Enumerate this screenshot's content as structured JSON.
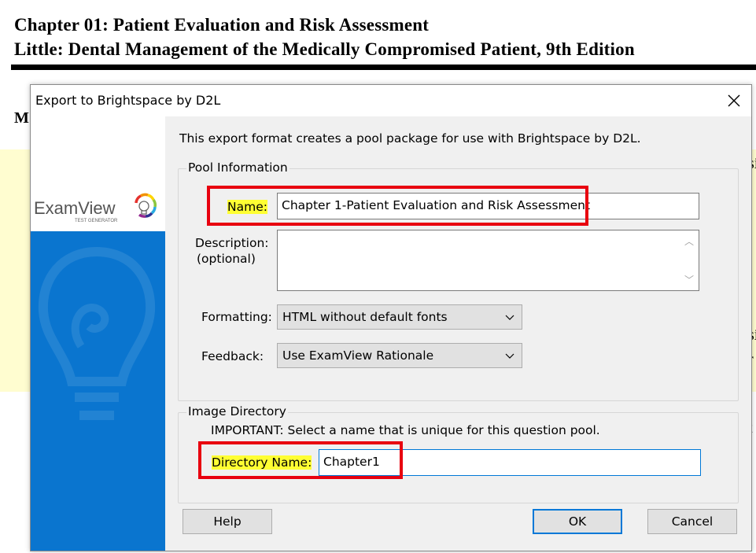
{
  "document": {
    "line1": "Chapter 01: Patient Evaluation and Risk Assessment",
    "line2": "Little: Dental Management of the Medically Compromised Patient, 9th Edition",
    "fragment_m": "M",
    "fragments": [
      "si",
      "si",
      "r",
      "t"
    ]
  },
  "dialog": {
    "title": "Export to Brightspace by D2L",
    "intro": "This export format creates a pool package for use with Brightspace by D2L.",
    "logo": {
      "text": "ExamView",
      "subtitle": "TEST GENERATOR"
    },
    "pool": {
      "legend": "Pool Information",
      "name_label": "Name:",
      "name_value": "Chapter 1-Patient Evaluation and Risk Assessment",
      "description_label_1": "Description:",
      "description_label_2": "(optional)",
      "description_value": "",
      "formatting_label": "Formatting:",
      "formatting_value": "HTML without default fonts",
      "feedback_label": "Feedback:",
      "feedback_value": "Use ExamView Rationale"
    },
    "image_dir": {
      "legend": "Image Directory",
      "important": "IMPORTANT: Select a name that is unique for this question pool.",
      "dir_label": "Directory Name:",
      "dir_value": "Chapter1"
    },
    "buttons": {
      "help": "Help",
      "ok": "OK",
      "cancel": "Cancel"
    }
  },
  "colors": {
    "highlight": "#ffff33",
    "annotation_red": "#e8000f",
    "accent_blue": "#0a75cf",
    "focus_blue": "#0078d7"
  }
}
